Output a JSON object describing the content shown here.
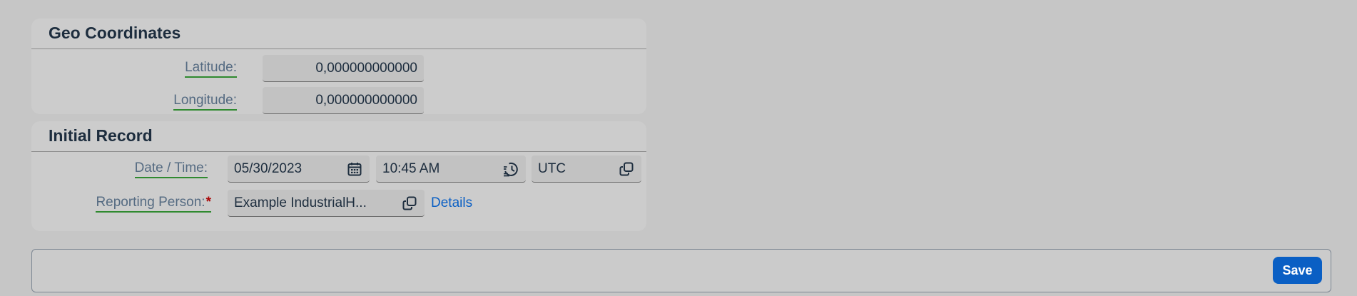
{
  "geo": {
    "title": "Geo Coordinates",
    "latitude_label": "Latitude:",
    "latitude_value": "0,000000000000",
    "longitude_label": "Longitude:",
    "longitude_value": "0,000000000000"
  },
  "initial": {
    "title": "Initial Record",
    "datetime_label": "Date / Time:",
    "date_value": "05/30/2023",
    "date_icon": "calendar-icon",
    "time_value": "10:45 AM",
    "time_icon": "history-clock-icon",
    "timezone_value": "UTC",
    "timezone_icon": "value-help-icon",
    "reporter_label": "Reporting Person:",
    "reporter_required": "*",
    "reporter_value": "Example IndustrialH...",
    "reporter_icon": "value-help-icon",
    "details_link": "Details"
  },
  "footer": {
    "save_label": "Save"
  },
  "colors": {
    "accent": "#0a5fc4",
    "label_underline": "#2f8a2f",
    "required": "#aa0808"
  }
}
